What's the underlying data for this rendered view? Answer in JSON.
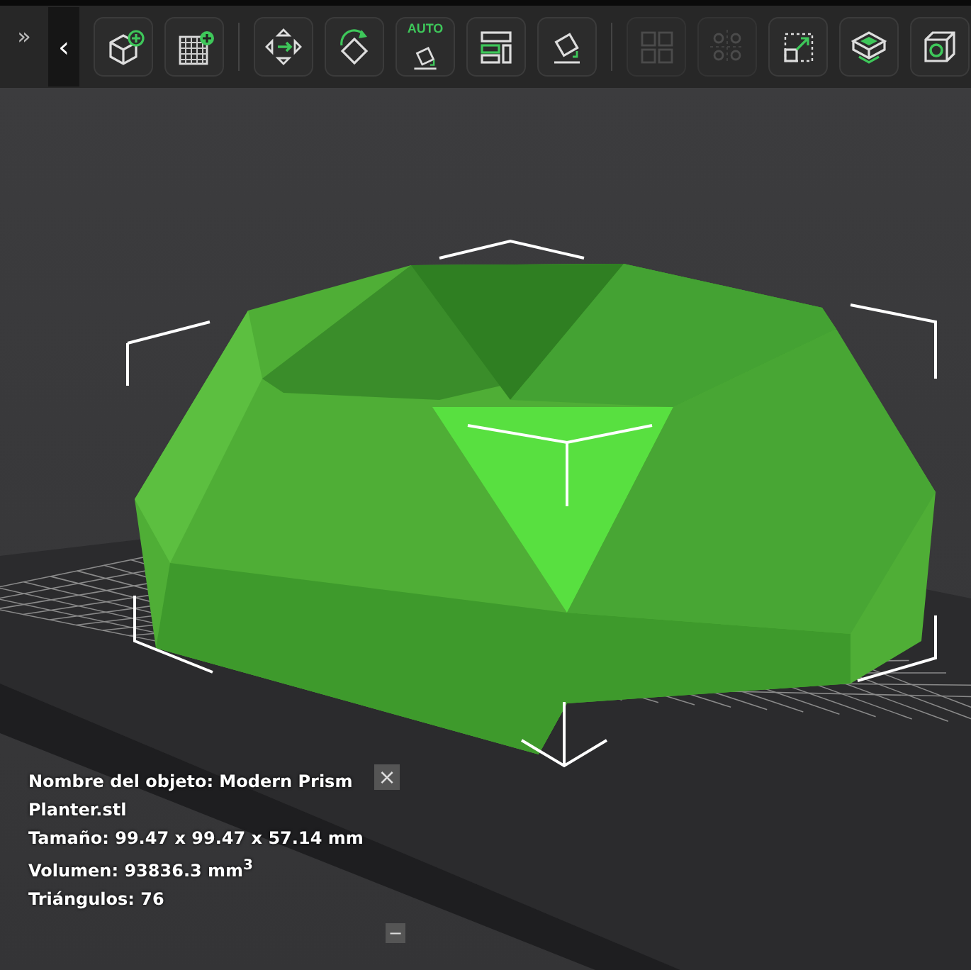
{
  "toolbar": {
    "expand": "»",
    "collapse": "‹",
    "tools": [
      {
        "kind": "add-object",
        "disabled": false
      },
      {
        "kind": "add-plate",
        "disabled": false
      },
      {
        "kind": "divider"
      },
      {
        "kind": "move",
        "disabled": false
      },
      {
        "kind": "rotate",
        "disabled": false
      },
      {
        "kind": "auto-orient",
        "disabled": false,
        "label": "AUTO"
      },
      {
        "kind": "arrange",
        "disabled": false
      },
      {
        "kind": "lay-flat",
        "disabled": false
      },
      {
        "kind": "divider"
      },
      {
        "kind": "split-objects",
        "disabled": true
      },
      {
        "kind": "split-parts",
        "disabled": true
      },
      {
        "kind": "scale",
        "disabled": false
      },
      {
        "kind": "slice-view",
        "disabled": false
      },
      {
        "kind": "cube-view",
        "disabled": false
      }
    ]
  },
  "object_info": {
    "lines": [
      "Nombre del objeto: Modern Prism Planter.stl",
      "Tamaño: 99.47 x 99.47 x 57.14 mm",
      "Volumen: 93836.3 mm$^{3}$",
      "Triángulos: 76"
    ],
    "close": "×",
    "minimize": "−"
  }
}
